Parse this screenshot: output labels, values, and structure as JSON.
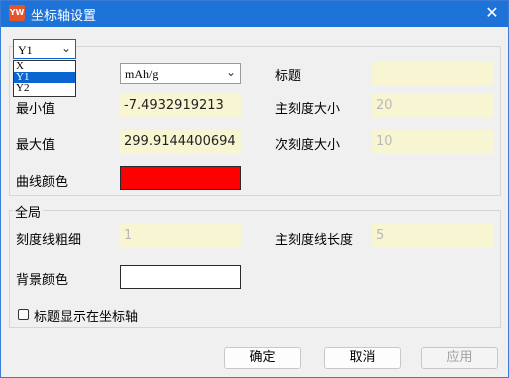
{
  "window": {
    "title": "坐标轴设置",
    "app_icon_text": "YW",
    "close_glyph": "✕"
  },
  "axis_select": {
    "value": "Y1",
    "options": [
      "X",
      "Y1",
      "Y2"
    ],
    "selected_index": 1
  },
  "axis_group": {
    "unit": "mAh/g",
    "title_label": "标题",
    "title_value": "",
    "min_label": "最小值",
    "min_value": "-7.4932919213",
    "max_label": "最大值",
    "max_value": "299.9144400694",
    "major_tick_label": "主刻度大小",
    "major_tick_value": "20",
    "minor_tick_label": "次刻度大小",
    "minor_tick_value": "10",
    "curve_color_label": "曲线颜色",
    "curve_color": "#ff0000"
  },
  "global_group": {
    "title": "全局",
    "tick_width_label": "刻度线粗细",
    "tick_width_value": "1",
    "major_tick_length_label": "主刻度线长度",
    "major_tick_length_value": "5",
    "bg_color_label": "背景颜色",
    "bg_color": "#ffffff",
    "show_title_label": "标题显示在坐标轴",
    "show_title_checked": false
  },
  "buttons": {
    "ok": "确定",
    "cancel": "取消",
    "apply": "应用"
  }
}
